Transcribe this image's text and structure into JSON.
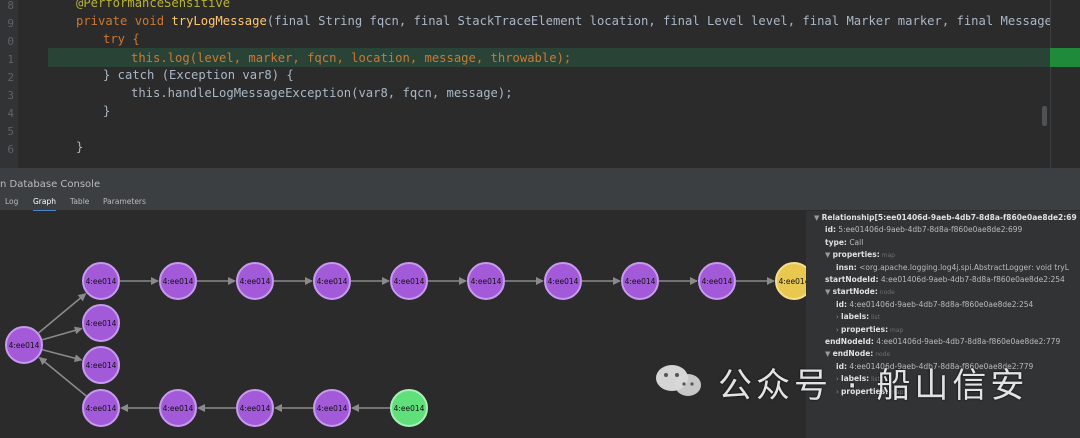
{
  "editor": {
    "gutter_numbers": [
      "8",
      "9",
      "0",
      "1",
      "2",
      "3",
      "4",
      "5",
      "6"
    ],
    "annotation": "@PerformanceSensitive",
    "signature_mod": "private void ",
    "signature_fn": "tryLogMessage",
    "signature_args": "(final String fqcn, final StackTraceElement location, final Level level, final Marker marker, final Message message, f",
    "try_line": "try {",
    "log_call": "this.log(level, marker, fqcn, location, message, throwable);",
    "catch_line": "} catch (Exception var8) {",
    "handle_call": "this.handleLogMessageException(var8, fqcn, message);",
    "close_inner": "}",
    "close_outer": "}"
  },
  "console": {
    "title": "n Database Console",
    "tabs": [
      "Log",
      "Graph",
      "Table",
      "Parameters"
    ],
    "active_tab": "Graph"
  },
  "graph": {
    "node_label": "4:ee014",
    "colors": {
      "purple": "#a35ad9",
      "yellow": "#e8c84f",
      "green": "#5fe07a",
      "edge": "#8a8a8a"
    }
  },
  "properties": {
    "rows": [
      {
        "indent": 0,
        "arrow": "▼",
        "key": "Relationship[5:ee01406d-9aeb-4db7-8d8a-f860e0ae8de2:69",
        "value": "",
        "type": ""
      },
      {
        "indent": 1,
        "arrow": "",
        "key": "id:",
        "value": "5:ee01406d-9aeb-4db7-8d8a-f860e0ae8de2:699",
        "type": ""
      },
      {
        "indent": 1,
        "arrow": "",
        "key": "type:",
        "value": "Call",
        "type": ""
      },
      {
        "indent": 1,
        "arrow": "▼",
        "key": "properties:",
        "value": "",
        "type": "map"
      },
      {
        "indent": 2,
        "arrow": "",
        "key": "insn:",
        "value": "<org.apache.logging.log4j.spi.AbstractLogger: void tryL",
        "type": ""
      },
      {
        "indent": 1,
        "arrow": "",
        "key": "startNodeId:",
        "value": "4:ee01406d-9aeb-4db7-8d8a-f860e0ae8de2:254",
        "type": ""
      },
      {
        "indent": 1,
        "arrow": "▼",
        "key": "startNode:",
        "value": "",
        "type": "node"
      },
      {
        "indent": 2,
        "arrow": "",
        "key": "id:",
        "value": "4:ee01406d-9aeb-4db7-8d8a-f860e0ae8de2:254",
        "type": ""
      },
      {
        "indent": 2,
        "arrow": "›",
        "key": "labels:",
        "value": "",
        "type": "list"
      },
      {
        "indent": 2,
        "arrow": "›",
        "key": "properties:",
        "value": "",
        "type": "map"
      },
      {
        "indent": 1,
        "arrow": "",
        "key": "endNodeId:",
        "value": "4:ee01406d-9aeb-4db7-8d8a-f860e0ae8de2:779",
        "type": ""
      },
      {
        "indent": 1,
        "arrow": "▼",
        "key": "endNode:",
        "value": "",
        "type": "node"
      },
      {
        "indent": 2,
        "arrow": "",
        "key": "id:",
        "value": "4:ee01406d-9aeb-4db7-8d8a-f860e0ae8de2:779",
        "type": ""
      },
      {
        "indent": 2,
        "arrow": "›",
        "key": "labels:",
        "value": "",
        "type": "list"
      },
      {
        "indent": 2,
        "arrow": "›",
        "key": "properties:",
        "value": "",
        "type": "map"
      }
    ]
  },
  "watermark": {
    "text": "公众号 · 船山信安"
  }
}
